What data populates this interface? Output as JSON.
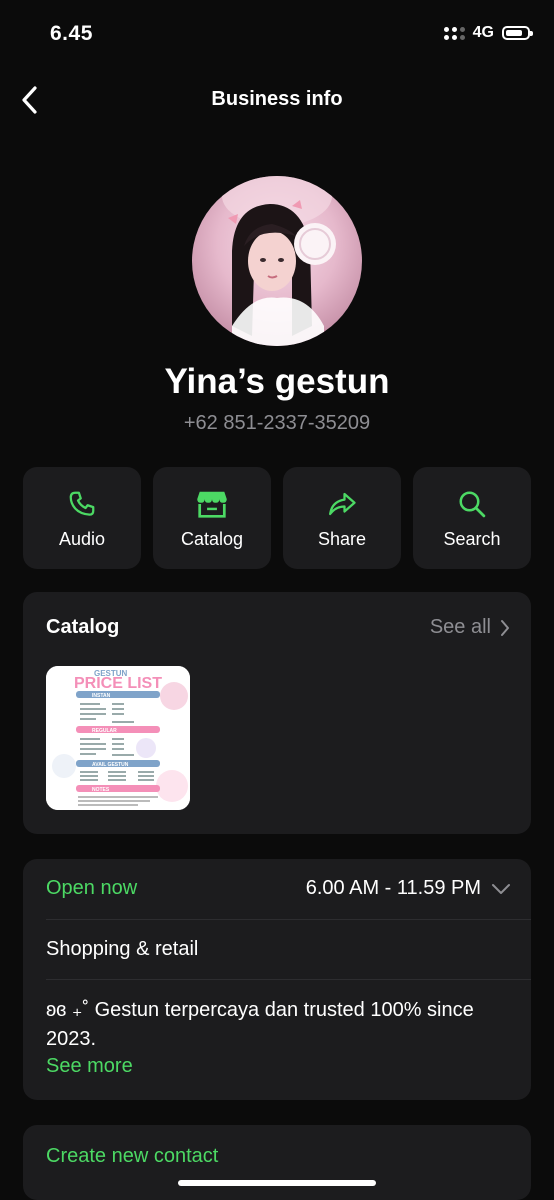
{
  "status_bar": {
    "time": "6.45",
    "network": "4G",
    "battery_level": 0.8
  },
  "header": {
    "title": "Business info"
  },
  "profile": {
    "name": "Yina’s gestun",
    "phone": "+62 851-2337-35209"
  },
  "actions": [
    {
      "label": "Audio",
      "icon": "phone-icon"
    },
    {
      "label": "Catalog",
      "icon": "store-icon"
    },
    {
      "label": "Share",
      "icon": "share-icon"
    },
    {
      "label": "Search",
      "icon": "search-icon"
    }
  ],
  "catalog": {
    "title": "Catalog",
    "see_all": "See all",
    "item": {
      "brand": "GESTUN",
      "heading": "PRICE LIST",
      "sections": [
        "INSTAN",
        "REGULAR",
        "AVAIL GESTUN",
        "NOTES"
      ]
    }
  },
  "business": {
    "open_status": "Open now",
    "hours": "6.00 AM - 11.59 PM",
    "category": "Shopping & retail",
    "description": "ʚɞ ₊˚ Gestun terpercaya dan trusted 100% since 2023.",
    "see_more": "See more"
  },
  "contact": {
    "create_label": "Create new contact"
  },
  "colors": {
    "accent": "#4cd964",
    "background": "#0b0b0b",
    "card": "#1c1c1e",
    "muted": "#8e8e93"
  }
}
